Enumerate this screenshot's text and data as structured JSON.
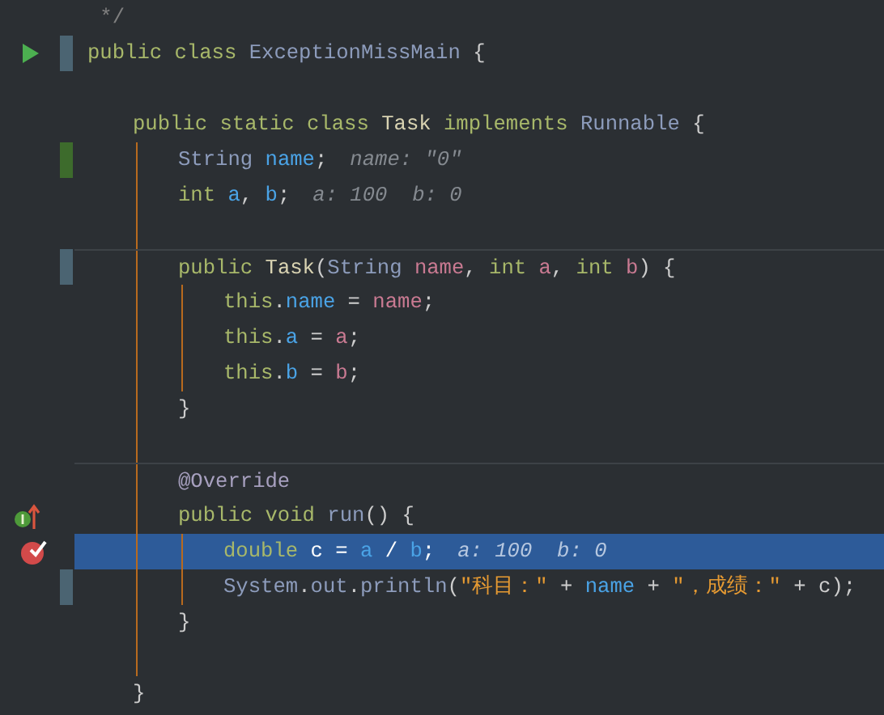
{
  "editor": {
    "lines": [
      {
        "kind": "code",
        "selected": false,
        "separator_above": false,
        "tokens": [
          {
            "kind": "comment",
            "text": " */"
          }
        ]
      },
      {
        "kind": "code",
        "selected": false,
        "separator_above": false,
        "gutter": {
          "kind": "run"
        },
        "change": {
          "kind": "modified"
        },
        "tokens": [
          {
            "kind": "keyword",
            "text": "public class "
          },
          {
            "kind": "type",
            "text": "ExceptionMissMain"
          },
          {
            "kind": "plain",
            "text": " {"
          }
        ],
        "children": [
          {
            "kind": "blank"
          },
          {
            "kind": "code",
            "selected": false,
            "separator_above": false,
            "tokens": [
              {
                "kind": "keyword",
                "text": "public static class "
              },
              {
                "kind": "declaration",
                "text": "Task"
              },
              {
                "kind": "keyword",
                "text": " implements "
              },
              {
                "kind": "type",
                "text": "Runnable"
              },
              {
                "kind": "plain",
                "text": " {"
              }
            ],
            "children": [
              {
                "kind": "code",
                "selected": false,
                "separator_above": false,
                "change": {
                  "kind": "added"
                },
                "tokens": [
                  {
                    "kind": "type",
                    "text": "String "
                  },
                  {
                    "kind": "field",
                    "text": "name"
                  },
                  {
                    "kind": "plain",
                    "text": ";"
                  }
                ],
                "hint": "name: \"0\""
              },
              {
                "kind": "code",
                "selected": false,
                "separator_above": false,
                "tokens": [
                  {
                    "kind": "keyword",
                    "text": "int "
                  },
                  {
                    "kind": "field",
                    "text": "a"
                  },
                  {
                    "kind": "plain",
                    "text": ", "
                  },
                  {
                    "kind": "field",
                    "text": "b"
                  },
                  {
                    "kind": "plain",
                    "text": ";"
                  }
                ],
                "hint": "a: 100  b: 0"
              },
              {
                "kind": "blank"
              },
              {
                "kind": "code",
                "selected": false,
                "separator_above": true,
                "change": {
                  "kind": "modified"
                },
                "tokens": [
                  {
                    "kind": "keyword",
                    "text": "public "
                  },
                  {
                    "kind": "declaration",
                    "text": "Task"
                  },
                  {
                    "kind": "plain",
                    "text": "("
                  },
                  {
                    "kind": "type",
                    "text": "String "
                  },
                  {
                    "kind": "param",
                    "text": "name"
                  },
                  {
                    "kind": "plain",
                    "text": ", "
                  },
                  {
                    "kind": "keyword",
                    "text": "int "
                  },
                  {
                    "kind": "param",
                    "text": "a"
                  },
                  {
                    "kind": "plain",
                    "text": ", "
                  },
                  {
                    "kind": "keyword",
                    "text": "int "
                  },
                  {
                    "kind": "param",
                    "text": "b"
                  },
                  {
                    "kind": "plain",
                    "text": ") {"
                  }
                ],
                "children": [
                  {
                    "kind": "code",
                    "selected": false,
                    "separator_above": false,
                    "tokens": [
                      {
                        "kind": "keyword",
                        "text": "this"
                      },
                      {
                        "kind": "plain",
                        "text": "."
                      },
                      {
                        "kind": "field",
                        "text": "name"
                      },
                      {
                        "kind": "plain",
                        "text": " = "
                      },
                      {
                        "kind": "param",
                        "text": "name"
                      },
                      {
                        "kind": "plain",
                        "text": ";"
                      }
                    ]
                  },
                  {
                    "kind": "code",
                    "selected": false,
                    "separator_above": false,
                    "tokens": [
                      {
                        "kind": "keyword",
                        "text": "this"
                      },
                      {
                        "kind": "plain",
                        "text": "."
                      },
                      {
                        "kind": "field",
                        "text": "a"
                      },
                      {
                        "kind": "plain",
                        "text": " = "
                      },
                      {
                        "kind": "param",
                        "text": "a"
                      },
                      {
                        "kind": "plain",
                        "text": ";"
                      }
                    ]
                  },
                  {
                    "kind": "code",
                    "selected": false,
                    "separator_above": false,
                    "tokens": [
                      {
                        "kind": "keyword",
                        "text": "this"
                      },
                      {
                        "kind": "plain",
                        "text": "."
                      },
                      {
                        "kind": "field",
                        "text": "b"
                      },
                      {
                        "kind": "plain",
                        "text": " = "
                      },
                      {
                        "kind": "param",
                        "text": "b"
                      },
                      {
                        "kind": "plain",
                        "text": ";"
                      }
                    ]
                  }
                ]
              },
              {
                "kind": "code",
                "selected": false,
                "separator_above": false,
                "tokens": [
                  {
                    "kind": "plain",
                    "text": "}"
                  }
                ]
              },
              {
                "kind": "blank"
              },
              {
                "kind": "code",
                "selected": false,
                "separator_above": true,
                "tokens": [
                  {
                    "kind": "annotation",
                    "text": "@Override"
                  }
                ]
              },
              {
                "kind": "code",
                "selected": false,
                "separator_above": false,
                "gutter": {
                  "kind": "implements"
                },
                "tokens": [
                  {
                    "kind": "keyword",
                    "text": "public void "
                  },
                  {
                    "kind": "type",
                    "text": "run"
                  },
                  {
                    "kind": "plain",
                    "text": "() {"
                  }
                ],
                "children": [
                  {
                    "kind": "code",
                    "selected": true,
                    "separator_above": false,
                    "gutter": {
                      "kind": "breakpoint"
                    },
                    "tokens": [
                      {
                        "kind": "keyword",
                        "text": "double "
                      },
                      {
                        "kind": "plain",
                        "text": "c = "
                      },
                      {
                        "kind": "field",
                        "text": "a"
                      },
                      {
                        "kind": "plain",
                        "text": " / "
                      },
                      {
                        "kind": "field",
                        "text": "b"
                      },
                      {
                        "kind": "plain",
                        "text": ";"
                      }
                    ],
                    "hint": "a: 100  b: 0"
                  },
                  {
                    "kind": "code",
                    "selected": false,
                    "separator_above": false,
                    "change": {
                      "kind": "modified"
                    },
                    "tokens": [
                      {
                        "kind": "type",
                        "text": "System"
                      },
                      {
                        "kind": "plain",
                        "text": "."
                      },
                      {
                        "kind": "type",
                        "text": "out"
                      },
                      {
                        "kind": "plain",
                        "text": "."
                      },
                      {
                        "kind": "type",
                        "text": "println"
                      },
                      {
                        "kind": "plain",
                        "text": "("
                      },
                      {
                        "kind": "string",
                        "text": "\"科目：\""
                      },
                      {
                        "kind": "plain",
                        "text": " + "
                      },
                      {
                        "kind": "field",
                        "text": "name"
                      },
                      {
                        "kind": "plain",
                        "text": " + "
                      },
                      {
                        "kind": "string",
                        "text": "\"，成绩：\""
                      },
                      {
                        "kind": "plain",
                        "text": " + c);"
                      }
                    ]
                  }
                ]
              },
              {
                "kind": "code",
                "selected": false,
                "separator_above": false,
                "tokens": [
                  {
                    "kind": "plain",
                    "text": "}"
                  }
                ]
              },
              {
                "kind": "blank"
              }
            ]
          },
          {
            "kind": "code",
            "selected": false,
            "separator_above": false,
            "tokens": [
              {
                "kind": "plain",
                "text": "}"
              }
            ]
          }
        ]
      }
    ]
  }
}
